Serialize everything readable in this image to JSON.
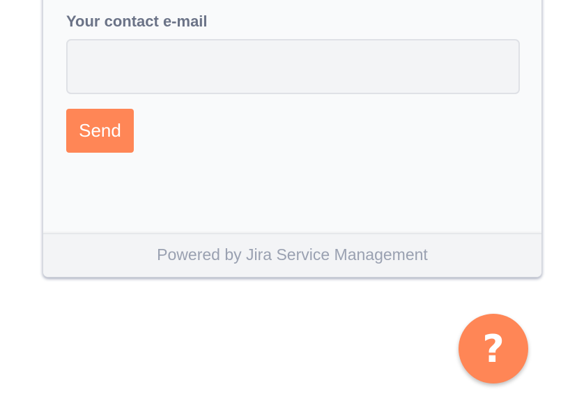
{
  "form": {
    "email_label": "Your contact e-mail",
    "email_value": "",
    "email_placeholder": "",
    "send_label": "Send"
  },
  "footer": {
    "text": "Powered by Jira Service Management"
  },
  "help_button": {
    "icon_name": "question-mark-icon",
    "glyph": "?"
  },
  "colors": {
    "accent": "#ff8656",
    "label": "#6b7387",
    "footer_text": "#9aa1b1"
  }
}
